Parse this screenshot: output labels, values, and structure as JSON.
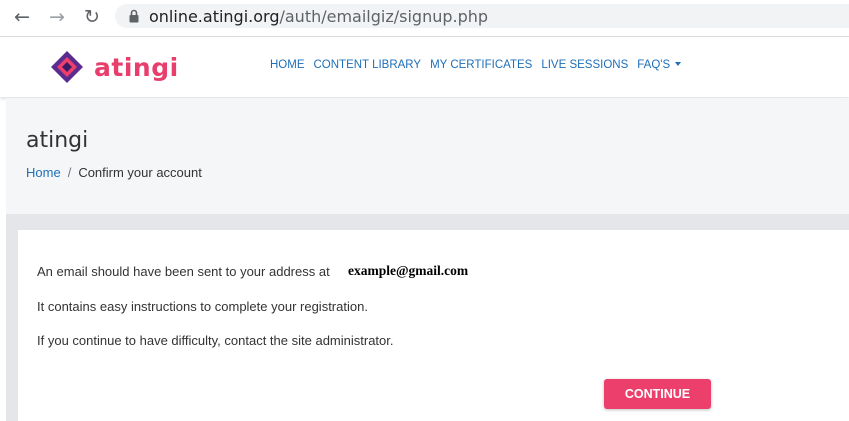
{
  "browser": {
    "back_icon": "back-arrow-icon",
    "forward_icon": "forward-arrow-icon",
    "reload_icon": "reload-icon",
    "lock_icon": "lock-icon",
    "url_host": "online.atingi.org",
    "url_path": "/auth/emailgiz/signup.php"
  },
  "header": {
    "logo_text": "atingi",
    "logo_colors": {
      "text": "#e83e6c",
      "diamond": "#5b2c8f",
      "accent": "#ec3f6c"
    },
    "nav": [
      {
        "label": "HOME"
      },
      {
        "label": "CONTENT LIBRARY"
      },
      {
        "label": "MY CERTIFICATES"
      },
      {
        "label": "LIVE SESSIONS"
      },
      {
        "label": "FAQ'S",
        "dropdown": true
      }
    ]
  },
  "page": {
    "title": "atingi",
    "breadcrumb": {
      "home": "Home",
      "separator": "/",
      "current": "Confirm your account"
    }
  },
  "content": {
    "line1": "An email should have been sent to your address at",
    "email": "example@gmail.com",
    "line2": "It contains easy instructions to complete your registration.",
    "line3": "If you continue to have difficulty, contact the site administrator.",
    "continue_label": "CONTINUE"
  },
  "colors": {
    "link": "#1f6fb7",
    "button": "#ec3f6c",
    "page_header_bg": "#f5f6f8",
    "content_bg": "#e4e6ea"
  }
}
